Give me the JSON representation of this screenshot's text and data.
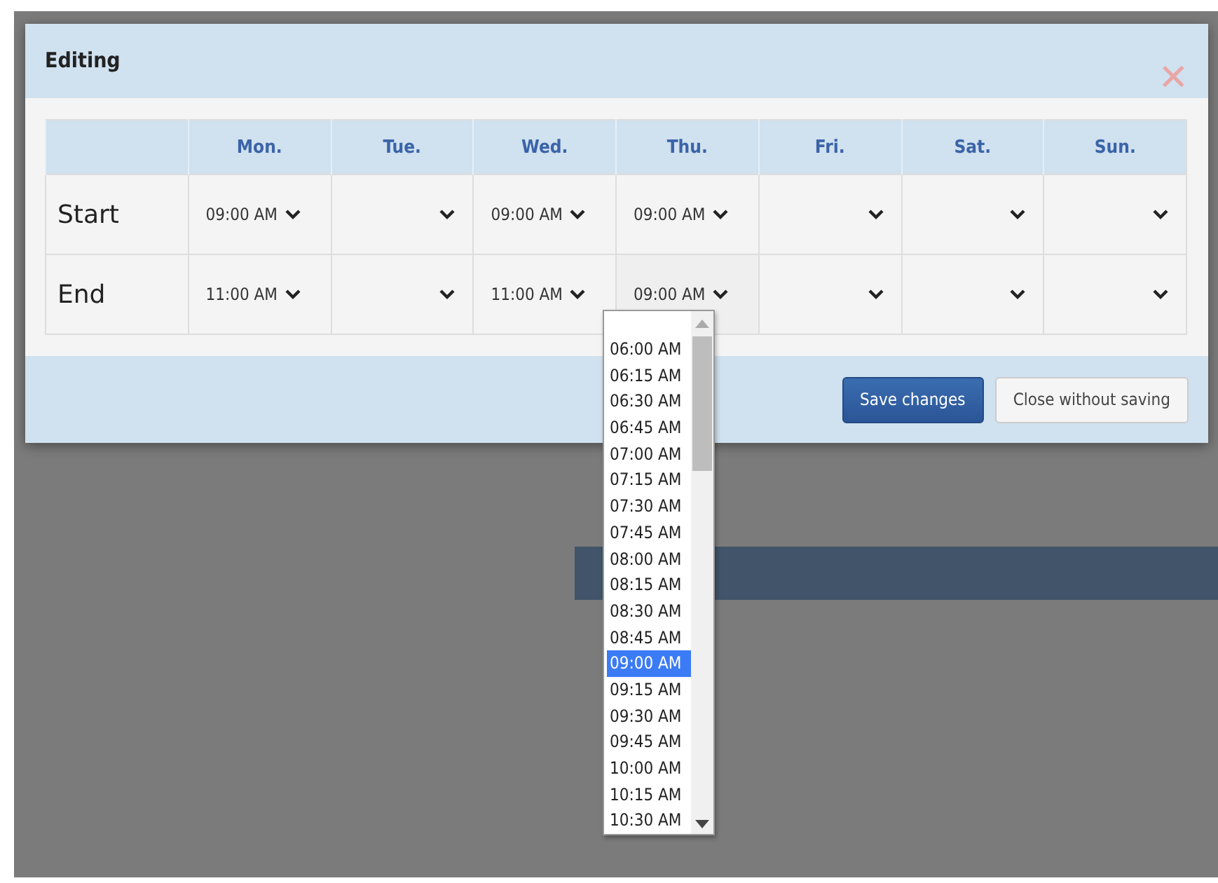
{
  "dialog": {
    "title": "Editing",
    "close_icon": "✕",
    "table": {
      "columns": [
        "Mon.",
        "Tue.",
        "Wed.",
        "Thu.",
        "Fri.",
        "Sat.",
        "Sun."
      ],
      "rows": [
        {
          "label": "Start",
          "cells": [
            {
              "value": "09:00 AM"
            },
            {},
            {
              "value": "09:00 AM"
            },
            {
              "value": "09:00 AM"
            },
            {},
            {},
            {}
          ]
        },
        {
          "label": "End",
          "cells": [
            {
              "value": "11:00 AM"
            },
            {},
            {
              "value": "11:00 AM"
            },
            {
              "value": "09:00 AM",
              "open": true
            },
            {},
            {},
            {}
          ]
        }
      ]
    },
    "buttons": [
      {
        "label": "Save changes",
        "kind": "primary"
      },
      {
        "label": "Close without saving",
        "kind": "secondary"
      }
    ]
  },
  "dropdown": {
    "options": [
      {
        "label": "06:00 AM",
        "selected": false
      },
      {
        "label": "06:15 AM",
        "selected": false
      },
      {
        "label": "06:30 AM",
        "selected": false
      },
      {
        "label": "06:45 AM",
        "selected": false
      },
      {
        "label": "07:00 AM",
        "selected": false
      },
      {
        "label": "07:15 AM",
        "selected": false
      },
      {
        "label": "07:30 AM",
        "selected": false
      },
      {
        "label": "07:45 AM",
        "selected": false
      },
      {
        "label": "08:00 AM",
        "selected": false
      },
      {
        "label": "08:15 AM",
        "selected": false
      },
      {
        "label": "08:30 AM",
        "selected": false
      },
      {
        "label": "08:45 AM",
        "selected": false
      },
      {
        "label": "09:00 AM",
        "selected": true
      },
      {
        "label": "09:15 AM",
        "selected": false
      },
      {
        "label": "09:30 AM",
        "selected": false
      },
      {
        "label": "09:45 AM",
        "selected": false
      },
      {
        "label": "10:00 AM",
        "selected": false
      },
      {
        "label": "10:15 AM",
        "selected": false
      },
      {
        "label": "10:30 AM",
        "selected": false
      }
    ]
  }
}
